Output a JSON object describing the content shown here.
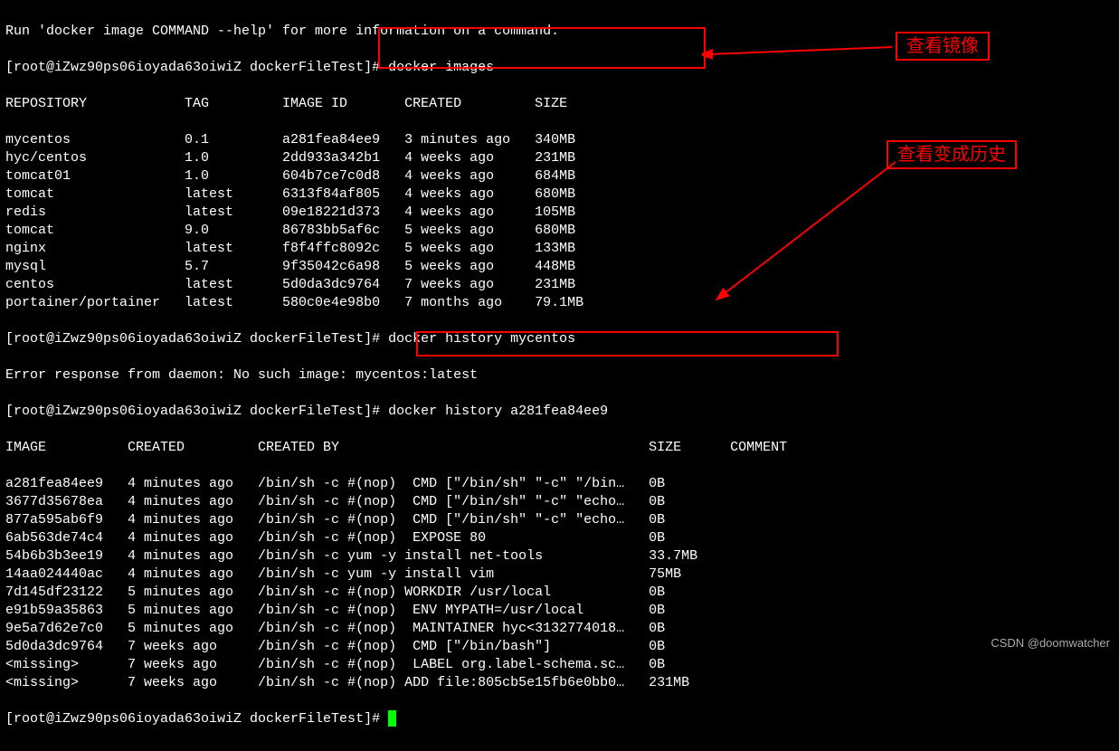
{
  "help_line": "Run 'docker image COMMAND --help' for more information on a command.",
  "prompt1": "[root@iZwz90ps06ioyada63oiwiZ dockerFileTest]# docker images",
  "images_header": "REPOSITORY            TAG         IMAGE ID       CREATED         SIZE",
  "images_rows": [
    "mycentos              0.1         a281fea84ee9   3 minutes ago   340MB",
    "hyc/centos            1.0         2dd933a342b1   4 weeks ago     231MB",
    "tomcat01              1.0         604b7ce7c0d8   4 weeks ago     684MB",
    "tomcat                latest      6313f84af805   4 weeks ago     680MB",
    "redis                 latest      09e18221d373   4 weeks ago     105MB",
    "tomcat                9.0         86783bb5af6c   5 weeks ago     680MB",
    "nginx                 latest      f8f4ffc8092c   5 weeks ago     133MB",
    "mysql                 5.7         9f35042c6a98   5 weeks ago     448MB",
    "centos                latest      5d0da3dc9764   7 weeks ago     231MB",
    "portainer/portainer   latest      580c0e4e98b0   7 months ago    79.1MB"
  ],
  "prompt2": "[root@iZwz90ps06ioyada63oiwiZ dockerFileTest]# docker history mycentos",
  "error_line": "Error response from daemon: No such image: mycentos:latest",
  "prompt3": "[root@iZwz90ps06ioyada63oiwiZ dockerFileTest]# docker history a281fea84ee9",
  "history_header": "IMAGE          CREATED         CREATED BY                                      SIZE      COMMENT",
  "history_rows": [
    "a281fea84ee9   4 minutes ago   /bin/sh -c #(nop)  CMD [\"/bin/sh\" \"-c\" \"/bin…   0B        ",
    "3677d35678ea   4 minutes ago   /bin/sh -c #(nop)  CMD [\"/bin/sh\" \"-c\" \"echo…   0B        ",
    "877a595ab6f9   4 minutes ago   /bin/sh -c #(nop)  CMD [\"/bin/sh\" \"-c\" \"echo…   0B        ",
    "6ab563de74c4   4 minutes ago   /bin/sh -c #(nop)  EXPOSE 80                    0B        ",
    "54b6b3b3ee19   4 minutes ago   /bin/sh -c yum -y install net-tools             33.7MB    ",
    "14aa024440ac   4 minutes ago   /bin/sh -c yum -y install vim                   75MB      ",
    "7d145df23122   5 minutes ago   /bin/sh -c #(nop) WORKDIR /usr/local            0B        ",
    "e91b59a35863   5 minutes ago   /bin/sh -c #(nop)  ENV MYPATH=/usr/local        0B        ",
    "9e5a7d62e7c0   5 minutes ago   /bin/sh -c #(nop)  MAINTAINER hyc<3132774018…   0B        ",
    "5d0da3dc9764   7 weeks ago     /bin/sh -c #(nop)  CMD [\"/bin/bash\"]            0B        ",
    "<missing>      7 weeks ago     /bin/sh -c #(nop)  LABEL org.label-schema.sc…   0B        ",
    "<missing>      7 weeks ago     /bin/sh -c #(nop) ADD file:805cb5e15fb6e0bb0…   231MB     "
  ],
  "prompt_end": "[root@iZwz90ps06ioyada63oiwiZ dockerFileTest]# ",
  "annotation1_label": "查看镜像",
  "annotation2_label": "查看变成历史",
  "watermark": "CSDN @doomwatcher"
}
